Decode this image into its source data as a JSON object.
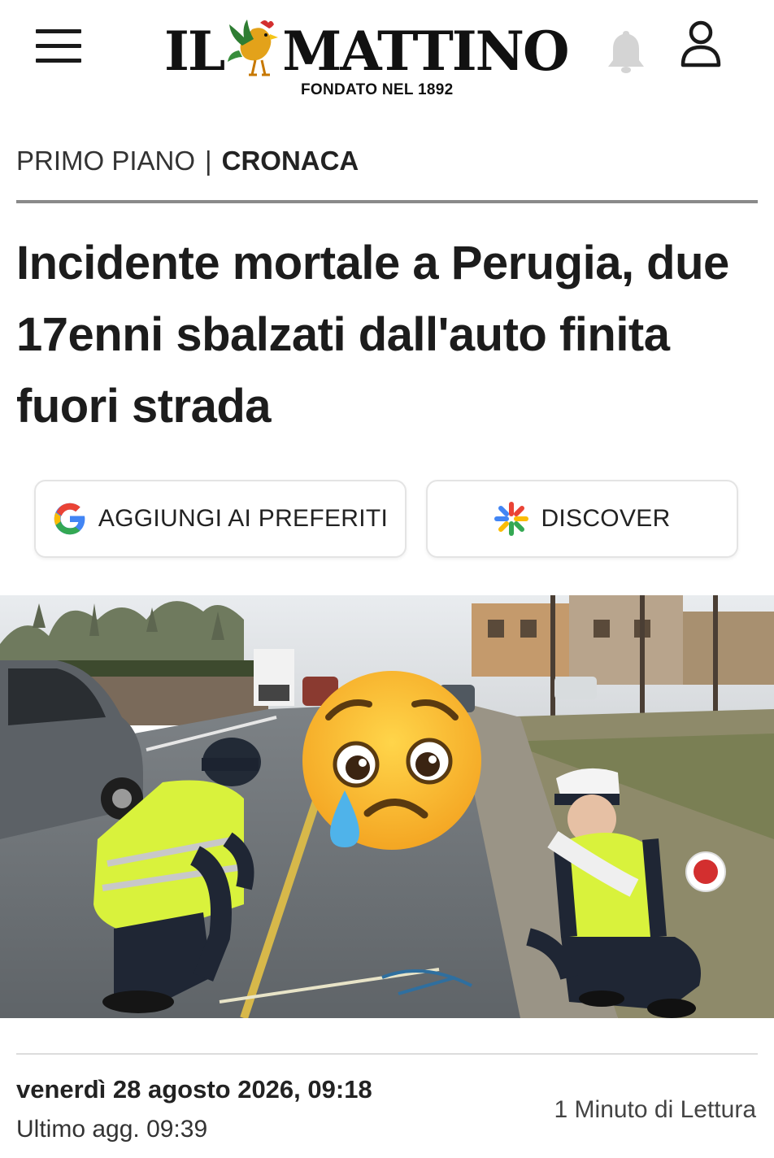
{
  "header": {
    "logo_text_left": "IL",
    "logo_text_right": "MATTINO",
    "logo_subtitle": "FONDATO NEL 1892",
    "menu_icon": "hamburger-menu-icon",
    "notification_icon": "bell-icon",
    "account_icon": "user-icon"
  },
  "breadcrumb": {
    "section": "PRIMO PIANO",
    "separator": "|",
    "category": "CRONACA"
  },
  "article": {
    "headline": "Incidente mortale a Perugia, due 17enni sbalzati dall'auto finita fuori strada",
    "date": "venerdì 28 agosto 2026, 09:18",
    "updated": "Ultimo agg. 09:39",
    "read_time": "1 Minuto di Lettura"
  },
  "actions": {
    "favorites_label": "AGGIUNGI AI PREFERITI",
    "favorites_icon": "google-icon",
    "discover_label": "DISCOVER",
    "discover_icon": "discover-sparkle-icon"
  },
  "photo": {
    "overlay_icon": "crying-face-emoji",
    "colors": {
      "road": "#5f6468",
      "vest": "#d9f23c",
      "sky": "#e9ecef"
    }
  }
}
